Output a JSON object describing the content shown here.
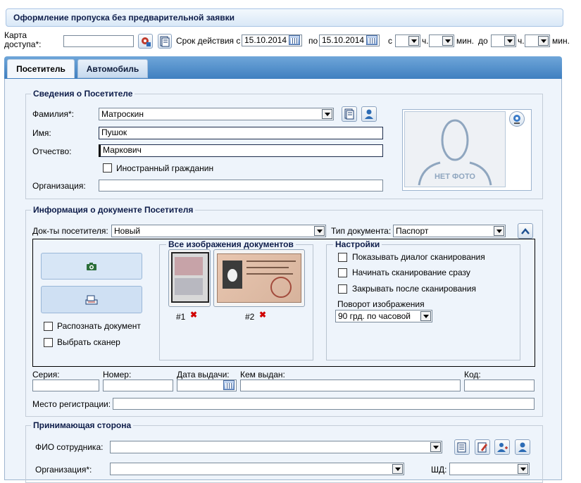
{
  "header": {
    "title": "Оформление пропуска без предварительной заявки"
  },
  "access": {
    "card_label_1": "Карта",
    "card_label_2": "доступа*:",
    "validity_label": "Срок действия с",
    "date_from": "15.10.2014",
    "to_label": "по",
    "date_to": "15.10.2014",
    "from_time_label": "с",
    "hours_short": "ч.",
    "minutes_short": "мин.",
    "until_label": "до",
    "hours_short_2": "ч.",
    "minutes_short_2": "мин."
  },
  "tabs": [
    {
      "label": "Посетитель"
    },
    {
      "label": "Автомобиль"
    }
  ],
  "visitor": {
    "legend": "Сведения о Посетителе",
    "surname_label": "Фамилия*:",
    "surname": "Матроскин",
    "name_label": "Имя:",
    "name": "Пушок",
    "patronymic_label": "Отчество:",
    "patronymic": "Маркович",
    "foreign_label": "Иностранный гражданин",
    "org_label": "Организация:",
    "org": "",
    "photo_placeholder": "НЕТ ФОТО"
  },
  "document": {
    "legend": "Информация о документе Посетителя",
    "docs_label": "Док-ты посетителя:",
    "docs_value": "Новый",
    "type_label": "Тип документа:",
    "type_value": "Паспорт",
    "recognize_label": "Распознать документ",
    "choose_scanner_label": "Выбрать сканер",
    "images_legend": "Все изображения документов",
    "images": [
      {
        "label": "#1"
      },
      {
        "label": "#2"
      }
    ],
    "settings_legend": "Настройки",
    "settings": [
      {
        "label": "Показывать диалог сканирования"
      },
      {
        "label": "Начинать сканирование сразу"
      },
      {
        "label": "Закрывать после сканирования"
      }
    ],
    "rotation_label": "Поворот изображения",
    "rotation_value": "90 грд. по часовой",
    "series_label": "Серия:",
    "number_label": "Номер:",
    "issue_date_label": "Дата выдачи:",
    "issued_by_label": "Кем выдан:",
    "code_label": "Код:",
    "registration_label": "Место регистрации:"
  },
  "host": {
    "legend": "Принимающая сторона",
    "employee_label": "ФИО сотрудника:",
    "org_label": "Организация*:",
    "shd_label": "ШД:"
  }
}
